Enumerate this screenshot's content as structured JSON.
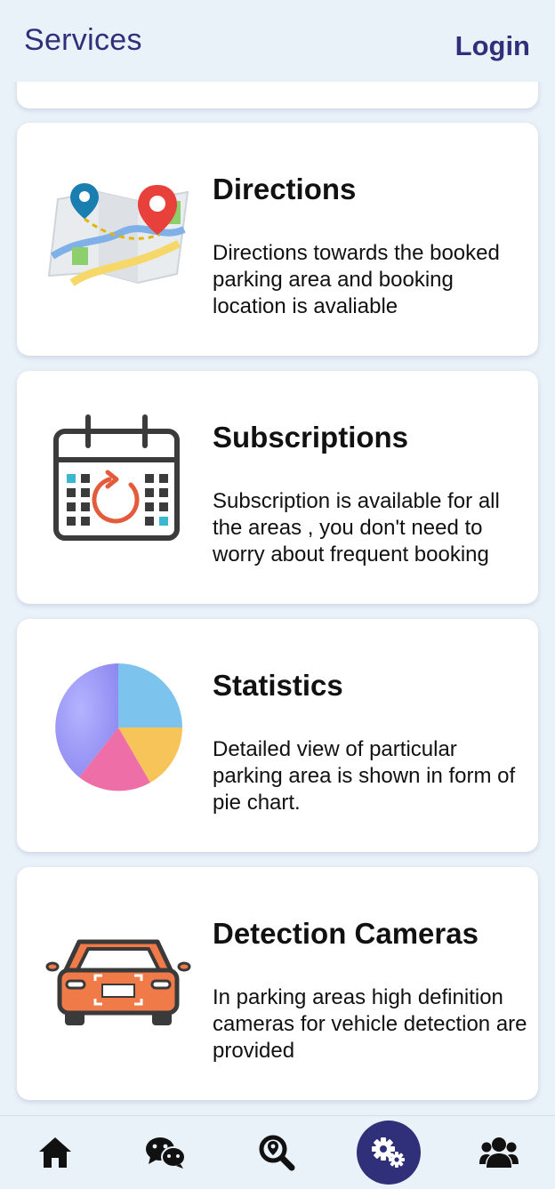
{
  "header": {
    "title": "Services",
    "login_label": "Login"
  },
  "cards": [
    {
      "title": "Directions",
      "description": "Directions towards the booked parking area and booking location is avaliable",
      "icon": "map-directions-icon"
    },
    {
      "title": "Subscriptions",
      "description": "Subscription is available for all the areas , you don't need to worry about frequent booking",
      "icon": "calendar-refresh-icon"
    },
    {
      "title": "Statistics",
      "description": "Detailed view of particular parking area is shown in form of pie chart.",
      "icon": "pie-chart-icon"
    },
    {
      "title": "Detection Cameras",
      "description": "In parking areas high definition cameras for vehicle detection are provided",
      "icon": "car-camera-icon"
    }
  ],
  "nav": {
    "items": [
      "home-icon",
      "chat-icon",
      "search-location-icon",
      "settings-icon",
      "users-icon"
    ],
    "active": "settings-icon",
    "active_color": "#2f2f7a"
  }
}
